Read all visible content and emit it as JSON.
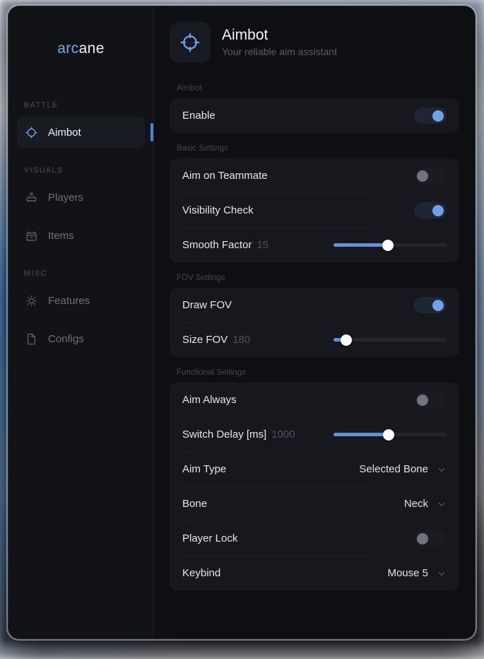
{
  "brand": {
    "accent_text": "arc",
    "rest_text": "ane",
    "accent_color": "#7ea9e8"
  },
  "sidebar": {
    "groups": [
      {
        "label": "BATTLE",
        "items": [
          {
            "label": "Aimbot",
            "icon": "crosshair-icon",
            "active": true
          }
        ]
      },
      {
        "label": "VISUALS",
        "items": [
          {
            "label": "Players",
            "icon": "players-icon",
            "active": false
          },
          {
            "label": "Items",
            "icon": "items-box-icon",
            "active": false
          }
        ]
      },
      {
        "label": "MISC",
        "items": [
          {
            "label": "Features",
            "icon": "gear-icon",
            "active": false
          },
          {
            "label": "Configs",
            "icon": "file-icon",
            "active": false
          }
        ]
      }
    ]
  },
  "page": {
    "icon": "crosshair-icon",
    "title": "Aimbot",
    "subtitle": "Your reliable aim assistant"
  },
  "sections": [
    {
      "label": "Aimbot",
      "rows": [
        {
          "type": "toggle",
          "label": "Enable",
          "state": "on"
        }
      ]
    },
    {
      "label": "Basic Settings",
      "rows": [
        {
          "type": "toggle",
          "label": "Aim on Teammate",
          "state": "off"
        },
        {
          "type": "toggle",
          "label": "Visibility Check",
          "state": "on"
        },
        {
          "type": "slider",
          "label": "Smooth Factor",
          "value": "15",
          "percent": 48
        }
      ]
    },
    {
      "label": "FOV Settings",
      "rows": [
        {
          "type": "toggle",
          "label": "Draw FOV",
          "state": "on"
        },
        {
          "type": "slider",
          "label": "Size FOV",
          "value": "180",
          "percent": 11
        }
      ]
    },
    {
      "label": "Functional Settings",
      "rows": [
        {
          "type": "toggle",
          "label": "Aim Always",
          "state": "off"
        },
        {
          "type": "slider",
          "label": "Switch Delay [ms]",
          "value": "1000",
          "percent": 49
        },
        {
          "type": "dropdown",
          "label": "Aim Type",
          "value": "Selected Bone"
        },
        {
          "type": "dropdown",
          "label": "Bone",
          "value": "Neck"
        },
        {
          "type": "toggle",
          "label": "Player Lock",
          "state": "off"
        },
        {
          "type": "dropdown",
          "label": "Keybind",
          "value": "Mouse 5"
        }
      ]
    }
  ],
  "colors": {
    "accent": "#6fa2e8",
    "slider_fill": "#6093dc",
    "window_bg": "#101114",
    "card_bg": "#16181e"
  }
}
